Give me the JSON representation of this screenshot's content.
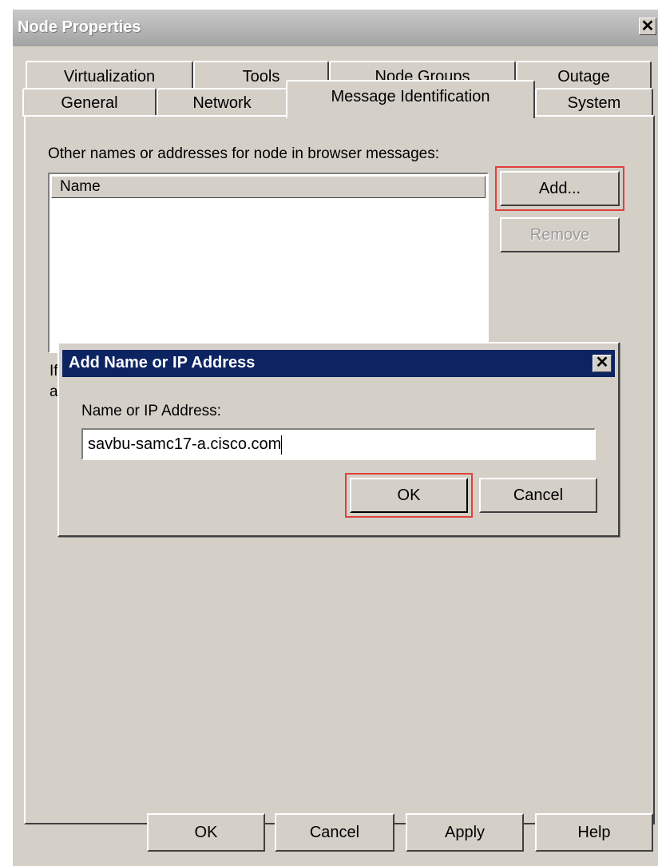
{
  "window": {
    "title": "Node Properties",
    "close_glyph": "✕"
  },
  "tabs_back": [
    "Virtualization",
    "Tools",
    "Node Groups",
    "Outage"
  ],
  "tabs_front": [
    "General",
    "Network",
    "Message Identification",
    "System"
  ],
  "active_tab": "Message Identification",
  "panel": {
    "description": "Other names or addresses for node in browser messages:",
    "list_header": "Name",
    "add_button": "Add...",
    "remove_button": "Remove",
    "partial_line1": "If",
    "partial_line2": "a"
  },
  "dialog": {
    "title": "Add Name or IP Address",
    "field_label": "Name or IP Address:",
    "field_value": "savbu-samc17-a.cisco.com",
    "ok_button": "OK",
    "cancel_button": "Cancel",
    "close_glyph": "✕"
  },
  "footer": {
    "ok": "OK",
    "cancel": "Cancel",
    "apply": "Apply",
    "help": "Help"
  },
  "colors": {
    "highlight": "#e0403a",
    "dialog_titlebar": "#0d2463"
  }
}
